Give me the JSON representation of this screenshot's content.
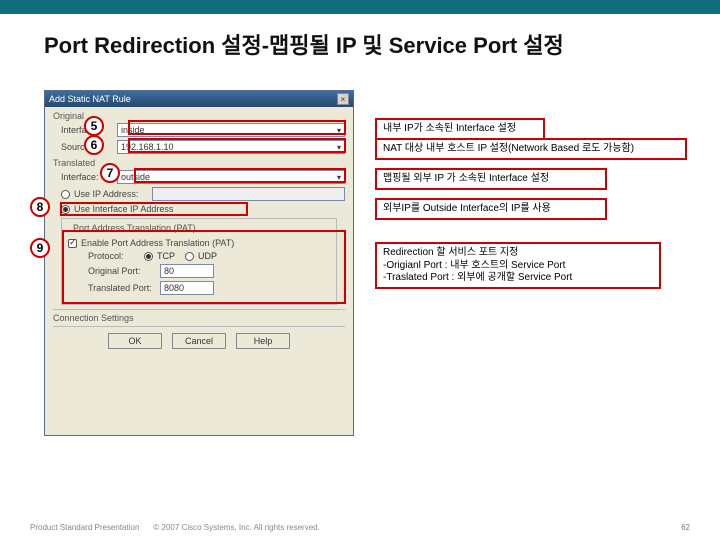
{
  "slide": {
    "title": "Port Redirection 설정-맵핑될 IP 및 Service Port 설정",
    "page_number": "62"
  },
  "dialog": {
    "title": "Add Static NAT Rule",
    "close": "×",
    "groups": {
      "original": "Original",
      "translated": "Translated",
      "pat": "Port Address Translation (PAT)",
      "conn": "Connection Settings"
    },
    "labels": {
      "interface": "Interface:",
      "source": "Source:",
      "use_ip": "Use IP Address:",
      "use_if_ip": "Use Interface IP Address",
      "enable_pat": "Enable Port Address Translation (PAT)",
      "protocol": "Protocol:",
      "tcp": "TCP",
      "udp": "UDP",
      "orig_port": "Original Port:",
      "trans_port": "Translated Port:"
    },
    "values": {
      "orig_interface": "inside",
      "source": "192.168.1.10",
      "trans_interface": "outside",
      "orig_port": "80",
      "trans_port": "8080"
    },
    "buttons": {
      "ok": "OK",
      "cancel": "Cancel",
      "help": "Help"
    }
  },
  "badges": {
    "n5": "5",
    "n6": "6",
    "n7": "7",
    "n8": "8",
    "n9": "9"
  },
  "callouts": {
    "c5": "내부 IP가 소속된 Interface 설정",
    "c6": "NAT 대상 내부 호스트 IP 설정(Network Based 로도 가능함)",
    "c7": "맵핑될 외부 IP 가 소속된 Interface 설정",
    "c8": "외부IP를 Outside Interface의 IP를 사용",
    "c9_l1": "Redirection 할 서비스 포트 지정",
    "c9_l2": "-Origianl Port : 내부 호스트의 Service Port",
    "c9_l3": "-Traslated Port : 외부에 공개할 Service Port"
  },
  "footer": {
    "left": "Product Standard Presentation",
    "mid": "© 2007 Cisco Systems, Inc. All rights reserved."
  }
}
